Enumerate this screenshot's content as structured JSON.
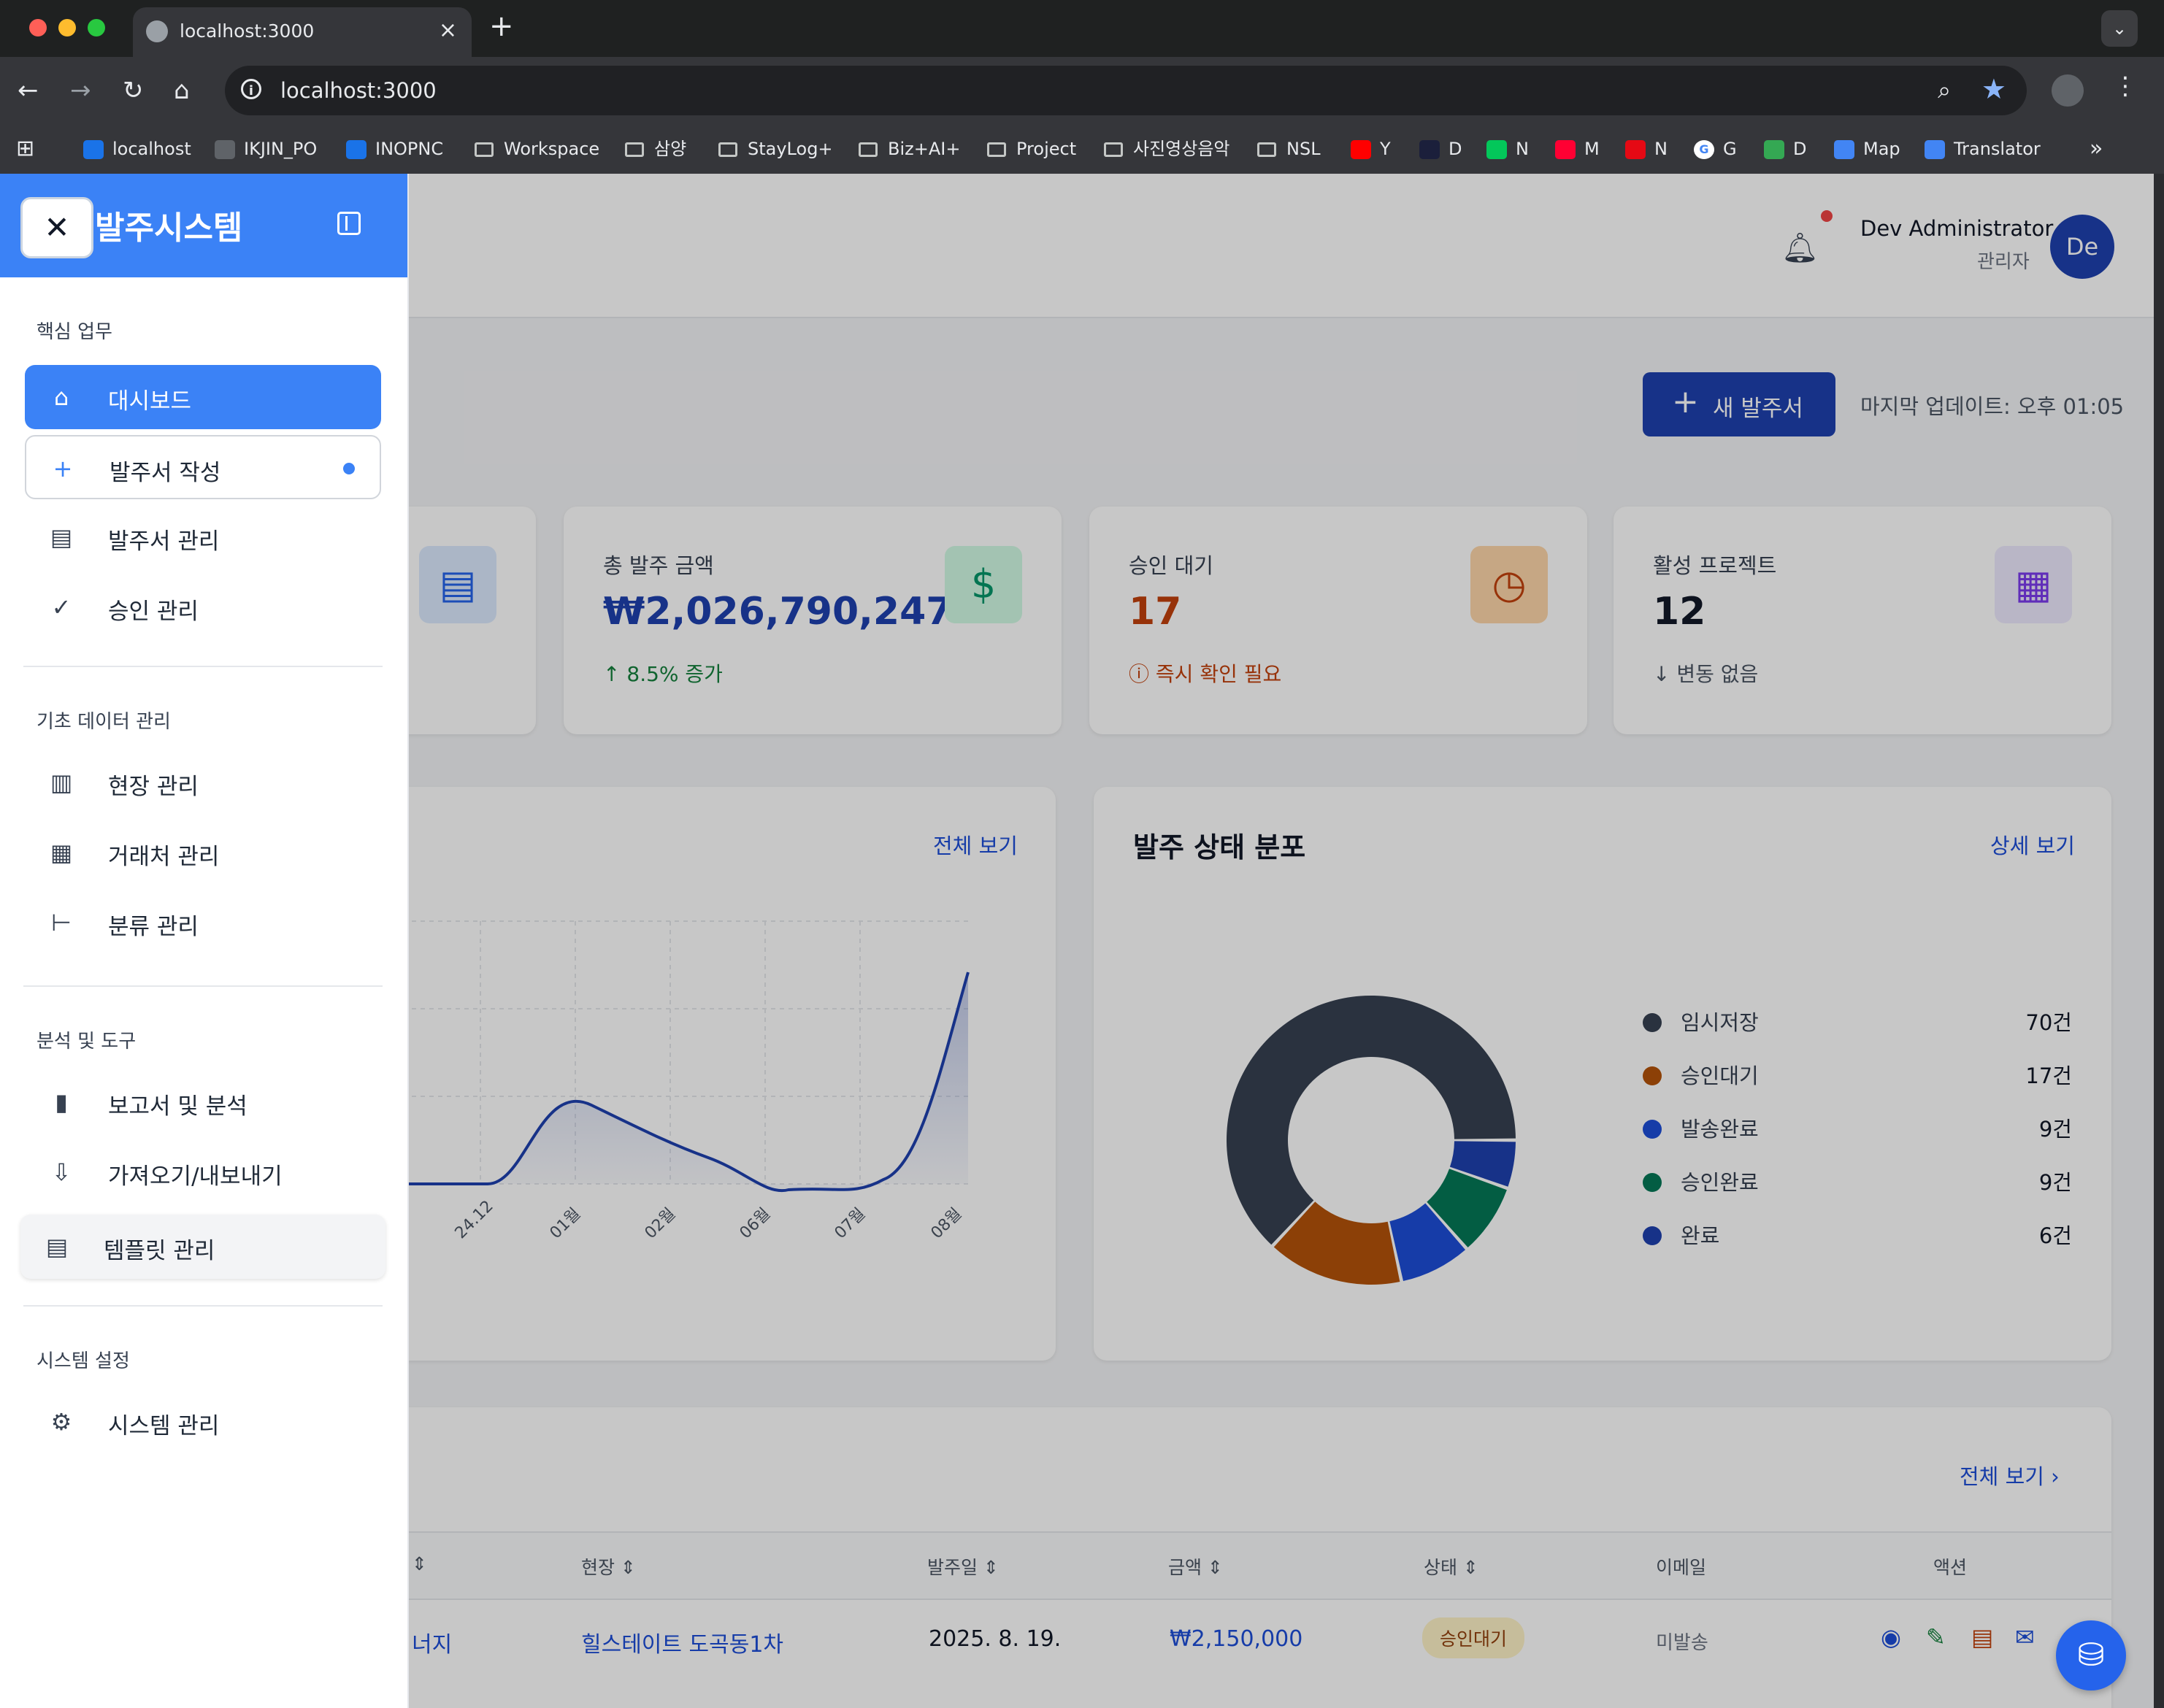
{
  "browser": {
    "tab_title": "localhost:3000",
    "url": "localhost:3000",
    "bookmarks": [
      {
        "label": "localhost",
        "icon": "app-icon"
      },
      {
        "label": "IKJIN_PO",
        "icon": "globe-icon"
      },
      {
        "label": "INOPNC",
        "icon": "app-icon"
      },
      {
        "label": "Workspace",
        "icon": "folder-icon"
      },
      {
        "label": "삼양",
        "icon": "folder-icon"
      },
      {
        "label": "StayLog+",
        "icon": "folder-icon"
      },
      {
        "label": "Biz+AI+",
        "icon": "folder-icon"
      },
      {
        "label": "Project",
        "icon": "folder-icon"
      },
      {
        "label": "사진영상음악",
        "icon": "folder-icon"
      },
      {
        "label": "NSL",
        "icon": "folder-icon"
      },
      {
        "label": "Y",
        "icon": "youtube-icon"
      },
      {
        "label": "D",
        "icon": "d-icon"
      },
      {
        "label": "N",
        "icon": "naver-icon"
      },
      {
        "label": "M",
        "icon": "music-icon"
      },
      {
        "label": "N",
        "icon": "netflix-icon"
      },
      {
        "label": "G",
        "icon": "google-icon"
      },
      {
        "label": "D",
        "icon": "drive-icon"
      },
      {
        "label": "Map",
        "icon": "maps-icon"
      },
      {
        "label": "Translator",
        "icon": "translate-icon"
      }
    ]
  },
  "header": {
    "user_name": "Dev Administrator",
    "user_role": "관리자",
    "avatar": "De"
  },
  "toolbar": {
    "new_order": "새 발주서",
    "last_update": "마지막 업데이트: 오후 01:05"
  },
  "stats": [
    {
      "label": "총 발주 금액",
      "value": "₩2,026,790,247",
      "sub": "8.5% 증가",
      "icon": "dollar-icon",
      "color": "#1e40af",
      "sub_color": "#15803d"
    },
    {
      "label": "승인 대기",
      "value": "17",
      "sub": "즉시 확인 필요",
      "icon": "clock-icon",
      "color": "#c2410c",
      "sub_color": "#c2410c"
    },
    {
      "label": "활성 프로젝트",
      "value": "12",
      "sub": "변동 없음",
      "icon": "building-icon",
      "color": "#111827",
      "sub_color": "#4b5563"
    }
  ],
  "trend_card": {
    "view_all": "전체 보기",
    "x_labels": [
      "24.12",
      "01월",
      "02월",
      "06월",
      "07월",
      "08월"
    ]
  },
  "status_card": {
    "title": "발주 상태 분포",
    "detail": "상세 보기"
  },
  "chart_data": {
    "type": "pie",
    "categories": [
      "임시저장",
      "승인대기",
      "발송완료",
      "승인완료",
      "완료"
    ],
    "values": [
      70,
      17,
      9,
      9,
      6
    ],
    "labels": [
      "70건",
      "17건",
      "9건",
      "9건",
      "6건"
    ],
    "colors": [
      "#374151",
      "#b45309",
      "#1d4ed8",
      "#047857",
      "#1e40af"
    ]
  },
  "recent": {
    "view_all": "전체 보기",
    "columns": [
      "현장",
      "발주일",
      "금액",
      "상태",
      "이메일",
      "액션"
    ],
    "row": {
      "vendor": "너지",
      "site": "힐스테이트 도곡동1차",
      "date": "2025. 8. 19.",
      "amount": "₩2,150,000",
      "status": "승인대기",
      "email": "미발송"
    }
  },
  "sidebar": {
    "title": "발주시스템",
    "sections": {
      "core": "핵심 업무",
      "base": "기초 데이터 관리",
      "analysis": "분석 및 도구",
      "system": "시스템 설정"
    },
    "items": [
      {
        "label": "대시보드",
        "icon": "home-icon"
      },
      {
        "label": "발주서 작성",
        "icon": "plus-icon"
      },
      {
        "label": "발주서 관리",
        "icon": "document-icon"
      },
      {
        "label": "승인 관리",
        "icon": "check-circle-icon"
      },
      {
        "label": "현장 관리",
        "icon": "building-icon"
      },
      {
        "label": "거래처 관리",
        "icon": "office-icon"
      },
      {
        "label": "분류 관리",
        "icon": "tree-icon"
      },
      {
        "label": "보고서 및 분석",
        "icon": "bar-chart-icon"
      },
      {
        "label": "가져오기/내보내기",
        "icon": "download-icon"
      },
      {
        "label": "템플릿 관리",
        "icon": "template-icon"
      },
      {
        "label": "시스템 관리",
        "icon": "gear-icon"
      }
    ]
  }
}
